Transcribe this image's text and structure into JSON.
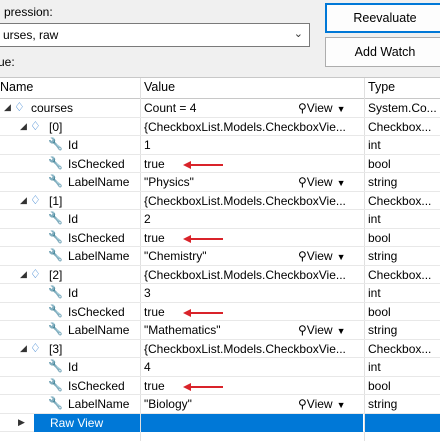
{
  "expression": {
    "label": "pression:",
    "value": "urses, raw"
  },
  "value_label": "ue:",
  "buttons": {
    "reevaluate": "Reevaluate",
    "add_watch": "Add Watch"
  },
  "headers": {
    "name": "Name",
    "value": "Value",
    "type": "Type"
  },
  "rows": [
    {
      "name": "courses",
      "value": "Count = 4",
      "type": "System.Co...",
      "view": "View"
    },
    {
      "name": "[0]",
      "value": "{CheckboxList.Models.CheckboxVie...",
      "type": "Checkbox..."
    },
    {
      "name": "Id",
      "value": "1",
      "type": "int"
    },
    {
      "name": "IsChecked",
      "value": "true",
      "type": "bool"
    },
    {
      "name": "LabelName",
      "value": "\"Physics\"",
      "type": "string",
      "view": "View"
    },
    {
      "name": "[1]",
      "value": "{CheckboxList.Models.CheckboxVie...",
      "type": "Checkbox..."
    },
    {
      "name": "Id",
      "value": "2",
      "type": "int"
    },
    {
      "name": "IsChecked",
      "value": "true",
      "type": "bool"
    },
    {
      "name": "LabelName",
      "value": "\"Chemistry\"",
      "type": "string",
      "view": "View"
    },
    {
      "name": "[2]",
      "value": "{CheckboxList.Models.CheckboxVie...",
      "type": "Checkbox..."
    },
    {
      "name": "Id",
      "value": "3",
      "type": "int"
    },
    {
      "name": "IsChecked",
      "value": "true",
      "type": "bool"
    },
    {
      "name": "LabelName",
      "value": "\"Mathematics\"",
      "type": "string",
      "view": "View"
    },
    {
      "name": "[3]",
      "value": "{CheckboxList.Models.CheckboxVie...",
      "type": "Checkbox..."
    },
    {
      "name": "Id",
      "value": "4",
      "type": "int"
    },
    {
      "name": "IsChecked",
      "value": "true",
      "type": "bool"
    },
    {
      "name": "LabelName",
      "value": "\"Biology\"",
      "type": "string",
      "view": "View"
    },
    {
      "name": "Raw View",
      "value": "",
      "type": ""
    }
  ],
  "colors": {
    "accent": "#0078d7",
    "arrow": "#d9232a",
    "object_icon": "#1a6fc9"
  },
  "icons": {
    "object": "object-cube-icon",
    "property": "wrench-icon",
    "search": "magnifier-icon"
  }
}
